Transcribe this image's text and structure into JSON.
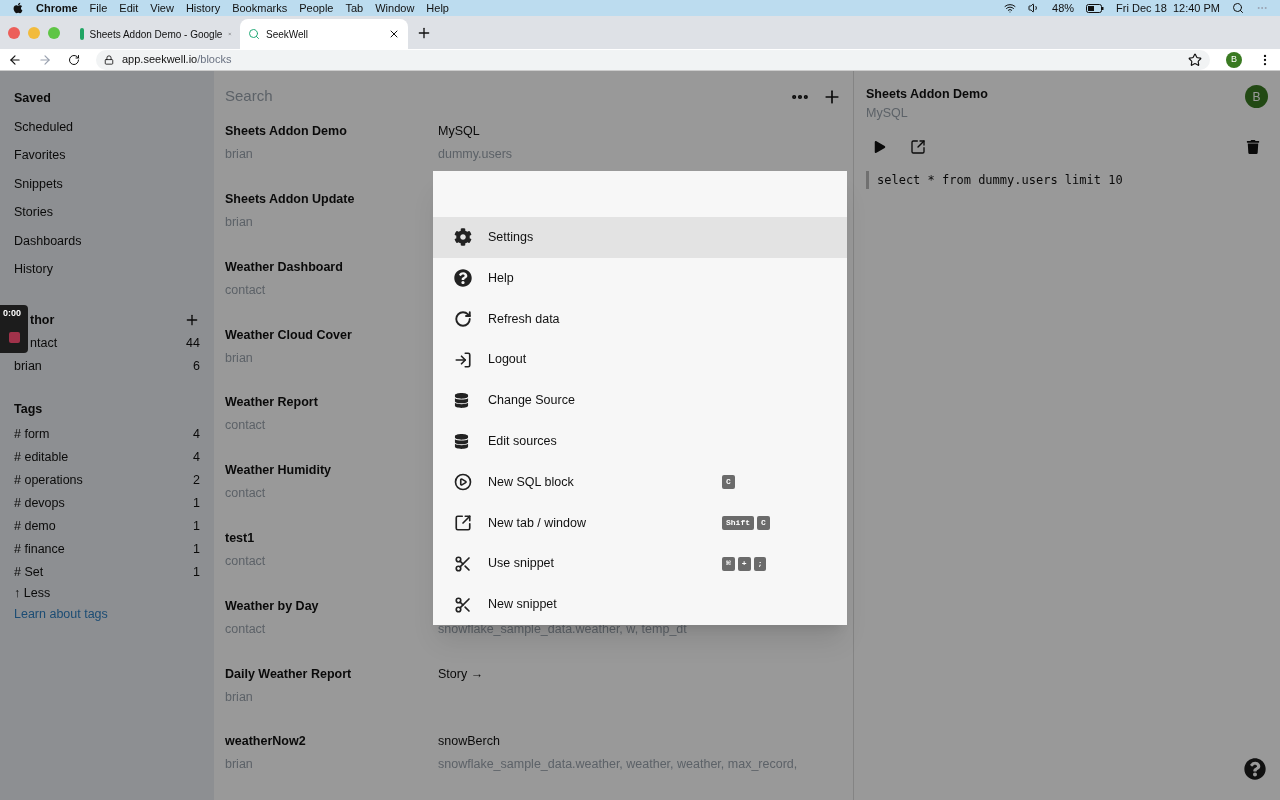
{
  "menu_bar": {
    "app": "Chrome",
    "menus": [
      "File",
      "Edit",
      "View",
      "History",
      "Bookmarks",
      "People",
      "Tab",
      "Window",
      "Help"
    ],
    "battery": "48%",
    "clock": "Fri Dec 18  12:40 PM"
  },
  "tabs": [
    {
      "label": "Sheets Addon Demo - Google",
      "selected": false
    },
    {
      "label": "SeekWell",
      "selected": true
    }
  ],
  "address": {
    "host": "app.seekwell.io",
    "path": "/blocks"
  },
  "profile": "B",
  "sidebar": {
    "nav": [
      {
        "label": "Saved",
        "selected": true
      },
      {
        "label": "Scheduled",
        "selected": false
      },
      {
        "label": "Favorites",
        "selected": false
      },
      {
        "label": "Snippets",
        "selected": false
      },
      {
        "label": "Stories",
        "selected": false
      },
      {
        "label": "Dashboards",
        "selected": false
      },
      {
        "label": "History",
        "selected": false
      }
    ],
    "author": {
      "heading": "thor",
      "items": [
        {
          "label": "ntact",
          "count": "44"
        },
        {
          "label": "brian",
          "count": "6"
        }
      ]
    },
    "tags": {
      "heading": "Tags",
      "items": [
        {
          "label": "# form",
          "count": "4"
        },
        {
          "label": "# editable",
          "count": "4"
        },
        {
          "label": "# operations",
          "count": "2"
        },
        {
          "label": "# devops",
          "count": "1"
        },
        {
          "label": "# demo",
          "count": "1"
        },
        {
          "label": "# finance",
          "count": "1"
        },
        {
          "label": "# Set",
          "count": "1"
        }
      ],
      "less": "↑ Less",
      "learn": "Learn about tags"
    }
  },
  "recorder": {
    "time": "0:00"
  },
  "list": {
    "search_placeholder": "Search",
    "rows": [
      {
        "title": "Sheets Addon Demo",
        "author": "brian",
        "source": "MySQL",
        "detail": "dummy.users"
      },
      {
        "title": "Sheets Addon Update",
        "author": "brian"
      },
      {
        "title": "Weather Dashboard",
        "author": "contact"
      },
      {
        "title": "Weather Cloud Cover",
        "author": "brian"
      },
      {
        "title": "Weather Report",
        "author": "contact"
      },
      {
        "title": "Weather Humidity",
        "author": "contact"
      },
      {
        "title": "test1",
        "author": "contact"
      },
      {
        "title": "Weather by Day",
        "author": "contact",
        "detail": "snowflake_sample_data.weather, w, temp_dt"
      },
      {
        "title": "Daily Weather Report",
        "author": "brian",
        "source": "Story →"
      },
      {
        "title": "weatherNow2",
        "author": "brian",
        "source": "snowBerch",
        "detail": "snowflake_sample_data.weather, weather, weather, max_record,"
      }
    ]
  },
  "detail": {
    "title": "Sheets Addon Demo",
    "source": "MySQL",
    "avatar": "B",
    "code": "select * from dummy.users limit 10"
  },
  "palette": {
    "items": [
      {
        "kind": "gear",
        "label": "Settings",
        "selected": true
      },
      {
        "kind": "help",
        "label": "Help",
        "selected": false
      },
      {
        "kind": "refresh",
        "label": "Refresh data",
        "selected": false
      },
      {
        "kind": "logout",
        "label": "Logout",
        "selected": false
      },
      {
        "kind": "database",
        "label": "Change Source",
        "selected": false
      },
      {
        "kind": "database",
        "label": "Edit sources",
        "selected": false
      },
      {
        "kind": "play",
        "label": "New SQL block",
        "selected": false,
        "keys": [
          "C"
        ]
      },
      {
        "kind": "external",
        "label": "New tab / window",
        "selected": false,
        "keys": [
          "Shift",
          "C"
        ]
      },
      {
        "kind": "scissors",
        "label": "Use snippet",
        "selected": false,
        "keys": [
          "⌘",
          "+",
          ";"
        ]
      },
      {
        "kind": "scissors",
        "label": "New snippet",
        "selected": false
      }
    ]
  }
}
